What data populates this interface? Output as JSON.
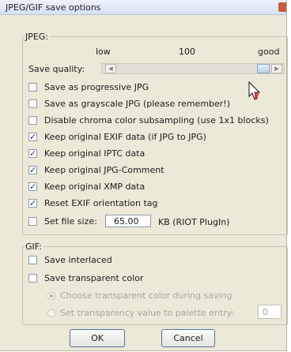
{
  "window": {
    "title": "JPEG/GIF save options"
  },
  "jpeg": {
    "group_label": "JPEG:",
    "scale_low": "low",
    "scale_mid": "100",
    "scale_high": "good",
    "quality_label": "Save quality:",
    "quality_value": 1.0,
    "options": [
      {
        "label": "Save as progressive JPG",
        "checked": false
      },
      {
        "label": "Save as grayscale JPG (please remember!)",
        "checked": false
      },
      {
        "label": "Disable chroma color subsampling (use 1x1 blocks)",
        "checked": false
      },
      {
        "label": "Keep original EXIF data (if JPG to JPG)",
        "checked": true
      },
      {
        "label": "Keep original IPTC data",
        "checked": true
      },
      {
        "label": "Keep original JPG-Comment",
        "checked": true
      },
      {
        "label": "Keep original XMP data",
        "checked": true
      },
      {
        "label": "Reset EXIF orientation tag",
        "checked": true
      }
    ],
    "filesize_label": "Set file size:",
    "filesize_value": "65.00",
    "filesize_unit": "KB (RIOT PlugIn)",
    "filesize_checked": false
  },
  "gif": {
    "group_label": "GIF:",
    "interlaced_label": "Save interlaced",
    "transparent_label": "Save transparent color",
    "choose_label": "Choose transparent color during saving",
    "palette_label": "Set transparency value to palette entry:",
    "palette_value": "0"
  },
  "buttons": {
    "ok": "OK",
    "cancel": "Cancel"
  }
}
